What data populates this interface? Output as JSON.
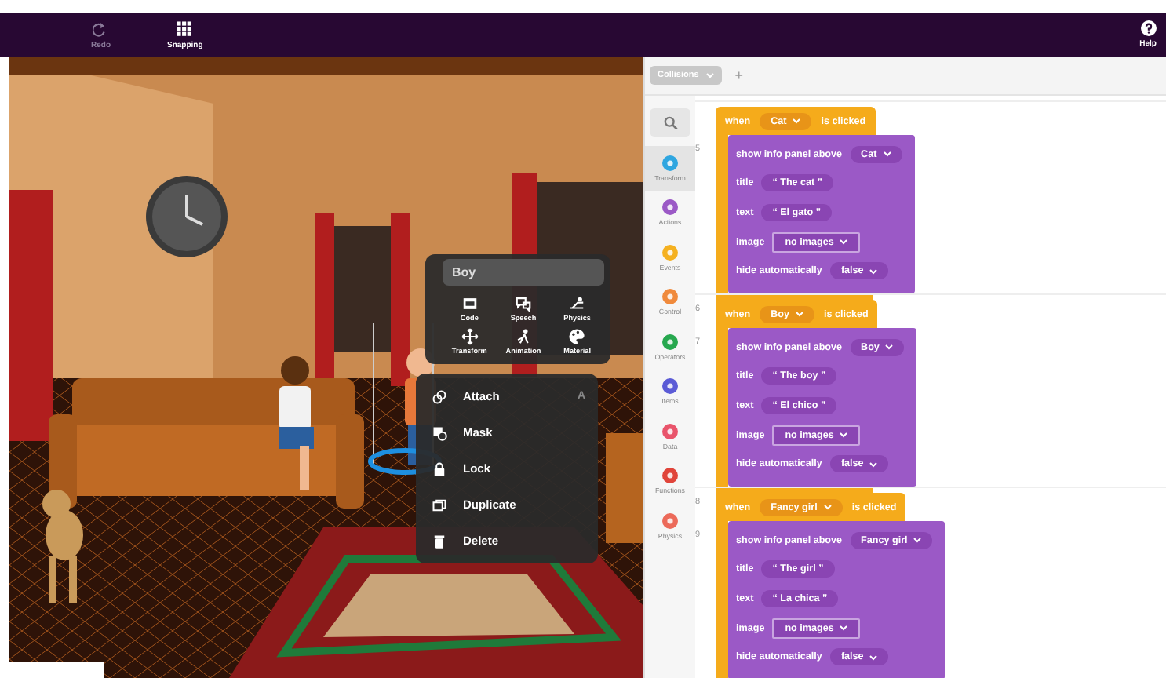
{
  "toolbar": {
    "buttons": [
      {
        "label": "Redo"
      },
      {
        "label": "Snapping"
      }
    ],
    "help": {
      "label": "Help"
    }
  },
  "scene": {
    "object_menu": {
      "title": "Boy",
      "tools": [
        {
          "label": "Code"
        },
        {
          "label": "Speech"
        },
        {
          "label": "Physics"
        },
        {
          "label": "Transform"
        },
        {
          "label": "Animation"
        },
        {
          "label": "Material"
        }
      ],
      "actions": [
        {
          "label": "Attach",
          "shortcut": "A"
        },
        {
          "label": "Mask"
        },
        {
          "label": "Lock"
        },
        {
          "label": "Duplicate"
        },
        {
          "label": "Delete"
        }
      ]
    }
  },
  "editor": {
    "tab": {
      "label": "Collisions"
    },
    "add_button": "+",
    "categories": [
      {
        "label": "Transform",
        "color": "#2fa6e0",
        "selected": true
      },
      {
        "label": "Actions",
        "color": "#9b59c6",
        "selected": false
      },
      {
        "label": "Events",
        "color": "#f5b120",
        "selected": false
      },
      {
        "label": "Control",
        "color": "#f08a3c",
        "selected": false
      },
      {
        "label": "Operators",
        "color": "#27a84f",
        "selected": false
      },
      {
        "label": "Items",
        "color": "#5b5bd6",
        "selected": false
      },
      {
        "label": "Data",
        "color": "#e9546b",
        "selected": false
      },
      {
        "label": "Functions",
        "color": "#e0443a",
        "selected": false
      },
      {
        "label": "Physics",
        "color": "#ec6a5a",
        "selected": false
      }
    ],
    "scripts": [
      {
        "body_line": "5",
        "event": {
          "prefix": "when",
          "object": "Cat",
          "suffix": "is clicked"
        },
        "rows": [
          {
            "kind": "dropdown",
            "label": "show info panel above",
            "value": "Cat"
          },
          {
            "kind": "string",
            "label": "title",
            "value": "“ The cat ”"
          },
          {
            "kind": "string",
            "label": "text",
            "value": "“ El gato ”"
          },
          {
            "kind": "menu",
            "label": "image",
            "value": "no images"
          },
          {
            "kind": "dropdown",
            "label": "hide automatically",
            "value": "false"
          }
        ]
      },
      {
        "when_line": "6",
        "body_line": "7",
        "event": {
          "prefix": "when",
          "object": "Boy",
          "suffix": "is clicked"
        },
        "rows": [
          {
            "kind": "dropdown",
            "label": "show info panel above",
            "value": "Boy"
          },
          {
            "kind": "string",
            "label": "title",
            "value": "“ The boy ”"
          },
          {
            "kind": "string",
            "label": "text",
            "value": "“ El chico ”"
          },
          {
            "kind": "menu",
            "label": "image",
            "value": "no images"
          },
          {
            "kind": "dropdown",
            "label": "hide automatically",
            "value": "false"
          }
        ]
      },
      {
        "when_line": "8",
        "body_line": "9",
        "event": {
          "prefix": "when",
          "object": "Fancy girl",
          "suffix": "is clicked"
        },
        "rows": [
          {
            "kind": "dropdown",
            "label": "show info panel above",
            "value": "Fancy girl"
          },
          {
            "kind": "string",
            "label": "title",
            "value": "“ The girl ”"
          },
          {
            "kind": "string",
            "label": "text",
            "value": "“ La chica ”"
          },
          {
            "kind": "menu",
            "label": "image",
            "value": "no images"
          },
          {
            "kind": "dropdown",
            "label": "hide automatically",
            "value": "false"
          }
        ]
      }
    ]
  }
}
